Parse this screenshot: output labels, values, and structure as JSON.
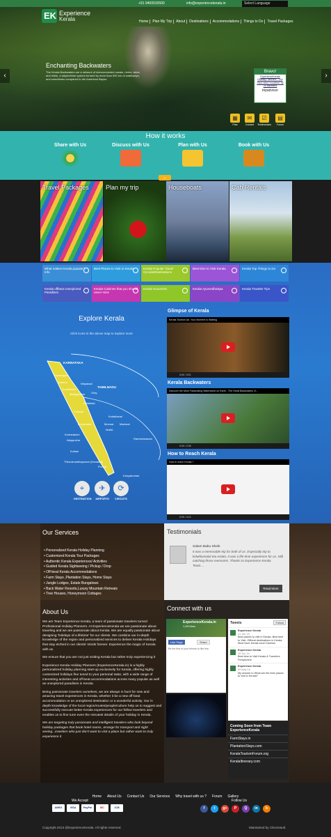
{
  "topbar": {
    "phone": "+91 9400010500",
    "email": "info@experiencekerala.in",
    "language": "Select Language"
  },
  "logo": {
    "mark": "EK",
    "line1": "Experience",
    "line2": "Kerala"
  },
  "nav": [
    "Home",
    "Plan My Trip",
    "About",
    "Destinations",
    "Accommodations",
    "Things to Do",
    "Travel Packages"
  ],
  "hero": {
    "title": "Enchanting Backwaters",
    "text": "The Kerala Backwaters are a network of interconnected canals, rivers, lakes and inlets, a labyrinthine system formed by more than 900 km of waterways, and sometimes compared to the American Bayou."
  },
  "bravo": {
    "title": "Bravo!",
    "text": "ExperienceKerala Holiday Planners - Our Trips rated 'excellent' by 25 travellers",
    "brand": "tripadvisor"
  },
  "quick": [
    "Plan",
    "Contact",
    "Testimonials",
    "Forum"
  ],
  "how": {
    "title": "How it works",
    "steps": [
      "Share with Us",
      "Discuss with Us",
      "Plan with Us",
      "Book with Us"
    ]
  },
  "tiles": [
    "Travel Packages",
    "Plan my trip",
    "Houseboats",
    "Cab Rentals"
  ],
  "menu_boxes": [
    {
      "label": "What makes Kerala popular?Info",
      "color": "#3a8fd6"
    },
    {
      "label": "Best Places to Visit in Kerala",
      "color": "#2f9ddd"
    },
    {
      "label": "Kerala Popular Travel Circuits/Destinations",
      "color": "#9bc82a"
    },
    {
      "label": "Best time to Visit Kerala",
      "color": "#9b55d6"
    },
    {
      "label": "Kerala Top Things to Do",
      "color": "#2e86d8"
    },
    {
      "label": "Kerala offbeat Unexplored Paradises",
      "color": "#4a5bbf"
    },
    {
      "label": "Kerala Cuisines that you should never miss",
      "color": "#c636b0"
    },
    {
      "label": "Kerala Souvenirs",
      "color": "#8fc628"
    },
    {
      "label": "Kerala AyurvedhaSpa",
      "color": "#8b46c8"
    },
    {
      "label": "Kerala Traveler Tips",
      "color": "#3a55c8"
    }
  ],
  "explore": {
    "title": "Explore Kerala",
    "subtitle": "Click icons in the above map to explore more",
    "icons": [
      "DESTINATION",
      "AIRPORTS",
      "CIRCUITS"
    ],
    "labels": [
      "KARNATAKA",
      "TAMILNADU",
      "Kasaragod",
      "Kannur",
      "Wayanad",
      "Kozhikode",
      "Malappuram",
      "Ooty",
      "Palakkad",
      "Thrissur",
      "Kodaikanal",
      "Ernakulam",
      "Munnar",
      "Idukki",
      "Madurai",
      "Kumarakom",
      "Alappuzha",
      "Kollam",
      "Rameshwaram",
      "Thiruvananthapuram (Kovalam)",
      "Poovar",
      "Kanyakumari"
    ]
  },
  "videos": [
    {
      "heading": "Glimpse of Kerala",
      "title": "Kerala Tourism Ad. Your Moment Is Waiting",
      "time": "0:00 / 3:01"
    },
    {
      "heading": "Kerala Backwaters",
      "title": "Discover the Most Fascinating Waterworld on Earth - The Great Backwaters, K...",
      "time": "0:00 / 2:28"
    },
    {
      "heading": "How to Reach Kerala",
      "title": "How to reach Kerala ?",
      "time": "0:00 / 4:14"
    }
  ],
  "services": {
    "title": "Our Services",
    "items": [
      "Personalized Kerala Holiday Planning",
      "Customized Kerala Tour Packages",
      "Authentic Kerala Experiences/ Activities",
      "Guided Kerala Sightseeing / Pickup / Drop",
      "Off-beat Kerala Accommodations",
      "Farm Stays ,Plantation Stays, Home Stays",
      "Jungle Lodges, Estate Bungalows",
      "Back Water Resorts,Luxury Mountain Retreats",
      "Tree Houses, Honeymoon Cottages"
    ]
  },
  "testimonials": {
    "title": "Testimonials",
    "name": "Salam Babu Sheik",
    "quote": "It was a memorable trip for both of us. Especially trip to kolukkumalai tea estate, it was a life-time experience for us. Still catching those memories. Thanks to Experience Kerala Team....",
    "button": "Read More"
  },
  "about": {
    "title": "About Us",
    "paras": [
      "We are Team Experience Kerala, a team of passionate travelers turned Professional Holiday Planners. At ExperienceKerala we are passionate about traveling and we are passionate about Kerala. We are equally passionate about designing 'holidays of a lifetime' for our clients. We combine our in-depth knowledge of the region and personalized services to deliver Kerala Holidays that stay etched in our clients' minds forever. Experience the magic of Kerala with us.",
      "We ensure that you are not just visiting Kerala but rather truly experiencing it",
      "Experience Kerala Holiday Planners (ExperienceKerala.in) is a highly personalized holiday planning start-up exclusively for Kerala, offering highly customized holidays fine tuned to your personal taste, with a wide range of interesting activities and off-beat accommodations across many popular as well as unexplored paradises in Kerala.",
      "Being passionate travelers ourselves, we are always in hunt for new and amazing travel experiences in Kerala, whether it be a new off-beat accommodation or an unexplored destination or a wonderful activity. Our in depth knowledge of the local region/routes/people/culture help us to suggest and successfully execute better Kerala experiences for our fellow travelers and enables us to fine tune even the minutest details of your holiday in Kerala.",
      "We are targeting truly passionate and intelligent travelers who look beyond holiday packages that book hotel rooms, arrange for transport and sight seeing...travelers who just don't want to visit a place but rather want to truly experience it"
    ]
  },
  "connect": {
    "title": "Connect with us",
    "fb_name": "ExperienceKerala.in",
    "fb_likes": "1,209 likes",
    "fb_like": "Like Page",
    "fb_share": "Share",
    "fb_friends": "Be the first of your friends to like this",
    "tw_title": "Tweets",
    "tw_follow": "Follow",
    "tweets": [
      {
        "user": "Experience Kerala",
        "date": "21 Jan 15",
        "text": "Best places to visit in Kerala, Best time to Visit, Offbeat destinations in Kerala, Must have Kerala local Cuisines"
      },
      {
        "user": "Experience Kerala",
        "date": "19 Jun 14",
        "text": "Best time to Visit Kerala & Travelers Perspective"
      },
      {
        "user": "Experience Kerala",
        "date": "09 May 14",
        "text": "My answer to What are the best places to visit in Kerala?"
      }
    ],
    "soon_title": "Coming Soon from Team ExperienceKerala",
    "soon": [
      "FarmStays.in",
      "PlantationStays.com",
      "KeralaTourismForum.org",
      "KeralaItinerary.com"
    ]
  },
  "footer": {
    "nav": [
      "Home",
      "About Us",
      "Contact Us",
      "Our Services",
      "Why travel with us ?",
      "Forum",
      "Gallery"
    ],
    "accept": "We Accept",
    "follow": "Follow Us",
    "pay": [
      "AMEX",
      "VISA",
      "PayPal",
      "MC",
      "JCB"
    ],
    "social": [
      "f",
      "t",
      "g+",
      "P",
      "Q",
      "in",
      "b"
    ],
    "copyright": "Copyright 2013 @ExperienceKerala. All rights reserved.",
    "maintained": "Maintained by CitrusVault."
  }
}
